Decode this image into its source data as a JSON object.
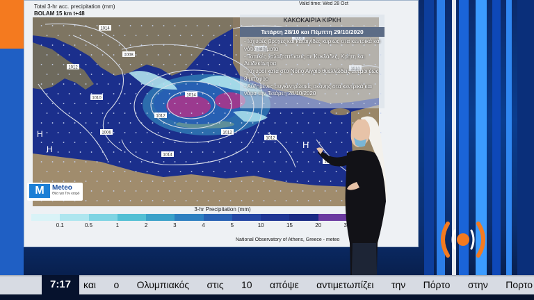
{
  "map": {
    "header_line1": "Total 3-hr acc. precipitation (mm)",
    "header_line2": "BOLAM 15 km t+48",
    "valid_time": "Valid time: Wed 28 Oct",
    "info_title": "ΚΑΚΟΚΑΙΡΙΑ ΚΙΡΚΗ",
    "info_subtitle": "Τετάρτη 28/10 και Πέμπτη 29/10/2020",
    "bullets": [
      "- Ισχυρές βροχές και καταιγίδες κυρίως στα κεντρικά και νότια τμήματα",
      "- Τοπικές χαλαζοπτώσεις σε Κυκλάδες, Κρήτη και Δωδεκάνησα",
      "- Ισχυροί κατά στο Νότιο Αιγαίο θυελλώδεις άνεμοι έως 8 μποφόρ",
      "- Αυξημένες συγκεντρώσεις σκόνης στα κεντρικά και νότια την Τετάρτη 28/10/2020"
    ],
    "isobars": [
      "1014",
      "1012",
      "1010",
      "1008",
      "1006",
      "1014",
      "1012",
      "1012",
      "1014",
      "1012",
      "1008",
      "1010",
      "1014",
      "1012"
    ],
    "pressure_centers": [
      "H",
      "H",
      "H"
    ],
    "legend_title": "3-hr Precipitation (mm)",
    "legend_ticks": [
      "0.1",
      "0.5",
      "1",
      "2",
      "3",
      "4",
      "5",
      "10",
      "15",
      "20",
      "30"
    ],
    "legend_colors": [
      "#d9f3f7",
      "#aee6ef",
      "#7fd4e3",
      "#52bfd4",
      "#3aa1c9",
      "#2d7fc0",
      "#2760b3",
      "#2446a3",
      "#1f3594",
      "#1a2a84",
      "#6b3aa0"
    ],
    "credit": "National Observatory of Athens, Greece - meteo",
    "meteo_logo_name": "Meteo",
    "meteo_logo_tagline": "Θέα για Τον καιρό"
  },
  "colors": {
    "sea": "#1b2f8c",
    "land": "#8a7a63",
    "storm_core": "#9b3a8f",
    "accent_orange": "#f47a1f"
  },
  "ticker": {
    "clock": "7:17",
    "text": "και ο Ολυμπιακός στις 10 απόψε αντιμετωπίζει την Πόρτο στην Πορτο"
  },
  "channel_logo": {
    "icon": "broadcast-signal-icon"
  }
}
